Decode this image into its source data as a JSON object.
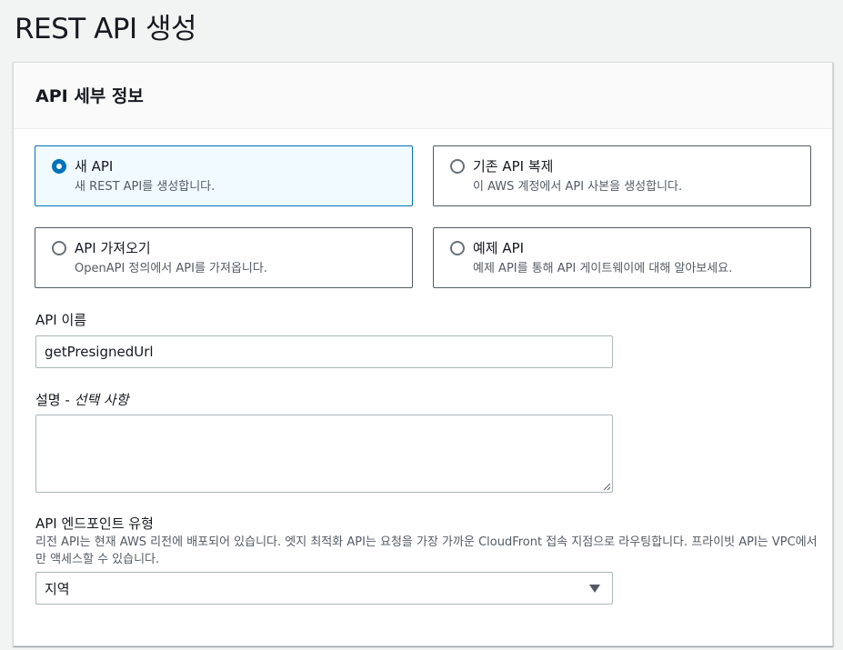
{
  "page": {
    "title": "REST API 생성"
  },
  "panel": {
    "title": "API 세부 정보"
  },
  "options": [
    {
      "title": "새 API",
      "description": "새 REST API를 생성합니다.",
      "selected": true
    },
    {
      "title": "기존 API 복제",
      "description": "이 AWS 계정에서 API 사본을 생성합니다.",
      "selected": false
    },
    {
      "title": "API 가져오기",
      "description": "OpenAPI 정의에서 API를 가져옵니다.",
      "selected": false
    },
    {
      "title": "예제 API",
      "description": "예제 API를 통해 API 게이트웨이에 대해 알아보세요.",
      "selected": false
    }
  ],
  "api_name": {
    "label": "API 이름",
    "value": "getPresignedUrl"
  },
  "description": {
    "label": "설명 - ",
    "optional": "선택 사항",
    "value": ""
  },
  "endpoint_type": {
    "label": "API 엔드포인트 유형",
    "helper": "리전 API는 현재 AWS 리전에 배포되어 있습니다. 엣지 최적화 API는 요청을 가장 가까운 CloudFront 접속 지점으로 라우팅합니다. 프라이빗 API는 VPC에서만 액세스할 수 있습니다.",
    "selected": "지역"
  },
  "colors": {
    "accent": "#0073bb",
    "selected_bg": "#f1faff",
    "page_bg": "#f2f3f3"
  }
}
